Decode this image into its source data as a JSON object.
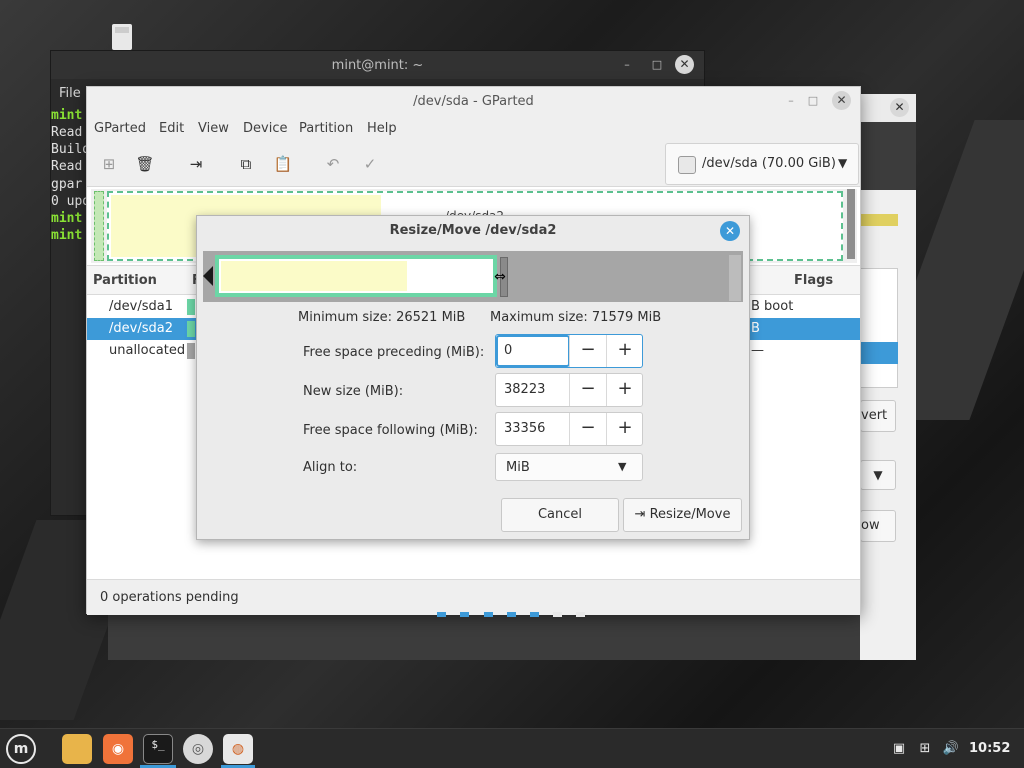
{
  "desktop": {
    "usb_icon": "usb-drive-icon"
  },
  "terminal": {
    "title": "mint@mint: ~",
    "menu_file": "File",
    "lines": [
      "mint",
      "Read",
      "Build",
      "Read",
      "gpar",
      "0 upd",
      "mint",
      "mint"
    ]
  },
  "gparted": {
    "title": "/dev/sda - GParted",
    "menu": [
      "GParted",
      "Edit",
      "View",
      "Device",
      "Partition",
      "Help"
    ],
    "device": "/dev/sda  (70.00 GiB)",
    "diskmap_label": "/dev/sda2",
    "columns": [
      "Partition",
      "F",
      "Flags"
    ],
    "rows": [
      {
        "partition": "/dev/sda1",
        "flags": "B  boot"
      },
      {
        "partition": "/dev/sda2",
        "flags": "B"
      },
      {
        "partition": "unallocated",
        "flags": "—"
      }
    ],
    "status": "0 operations pending"
  },
  "installer": {
    "revert_partial": "vert",
    "now_partial": "ow"
  },
  "dialog": {
    "title": "Resize/Move /dev/sda2",
    "min_size": "Minimum size: 26521 MiB",
    "max_size": "Maximum size: 71579 MiB",
    "preceding_label": "Free space preceding (MiB):",
    "preceding_value": "0",
    "newsize_label": "New size (MiB):",
    "newsize_value": "38223",
    "following_label": "Free space following (MiB):",
    "following_value": "33356",
    "align_label": "Align to:",
    "align_value": "MiB",
    "cancel": "Cancel",
    "resize": "Resize/Move"
  },
  "taskbar": {
    "clock": "10:52"
  },
  "colors": {
    "accent": "#3d9ad8",
    "partition_ext4": "#6cd6a6",
    "used_space": "#fbfbc8",
    "unallocated": "#a6a6a6"
  }
}
